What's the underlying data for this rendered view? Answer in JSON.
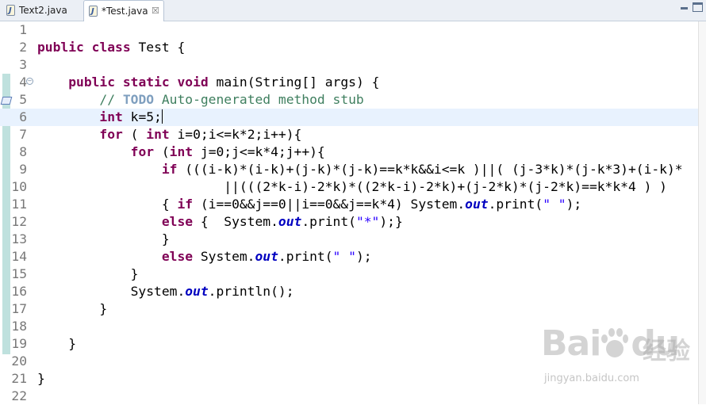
{
  "tabs": [
    {
      "label": "Text2.java",
      "active": false
    },
    {
      "label": "*Test.java",
      "active": true,
      "close": "☒"
    }
  ],
  "window_controls": {
    "minimize": "minimize-icon",
    "maximize": "maximize-icon"
  },
  "editor": {
    "current_line": 6,
    "lines": [
      {
        "n": "1",
        "tokens": []
      },
      {
        "n": "2",
        "tokens": [
          {
            "t": "public",
            "c": "kw"
          },
          {
            "t": " "
          },
          {
            "t": "class",
            "c": "kw"
          },
          {
            "t": " Test {"
          }
        ]
      },
      {
        "n": "3",
        "tokens": []
      },
      {
        "n": "4",
        "tokens": [
          {
            "t": "    "
          },
          {
            "t": "public",
            "c": "kw"
          },
          {
            "t": " "
          },
          {
            "t": "static",
            "c": "kw"
          },
          {
            "t": " "
          },
          {
            "t": "void",
            "c": "kw"
          },
          {
            "t": " main(String[] args) {"
          }
        ]
      },
      {
        "n": "5",
        "tokens": [
          {
            "t": "        "
          },
          {
            "t": "// ",
            "c": "cm"
          },
          {
            "t": "TODO",
            "c": "todo"
          },
          {
            "t": " Auto-generated method stub",
            "c": "cm"
          }
        ]
      },
      {
        "n": "6",
        "tokens": [
          {
            "t": "        "
          },
          {
            "t": "int",
            "c": "kw"
          },
          {
            "t": " k=5;"
          },
          {
            "t": "",
            "c": "caret"
          }
        ]
      },
      {
        "n": "7",
        "tokens": [
          {
            "t": "        "
          },
          {
            "t": "for",
            "c": "kw"
          },
          {
            "t": " ( "
          },
          {
            "t": "int",
            "c": "kw"
          },
          {
            "t": " i=0;i<=k*2;i++){"
          }
        ]
      },
      {
        "n": "8",
        "tokens": [
          {
            "t": "            "
          },
          {
            "t": "for",
            "c": "kw"
          },
          {
            "t": " ("
          },
          {
            "t": "int",
            "c": "kw"
          },
          {
            "t": " j=0;j<=k*4;j++){"
          }
        ]
      },
      {
        "n": "9",
        "tokens": [
          {
            "t": "                "
          },
          {
            "t": "if",
            "c": "kw"
          },
          {
            "t": " (((i-k)*(i-k)+(j-k)*(j-k)==k*k&&i<=k )||( (j-3*k)*(j-k*3)+(i-k)*"
          }
        ]
      },
      {
        "n": "10",
        "tokens": [
          {
            "t": "                        ||(((2*k-i)-2*k)*((2*k-i)-2*k)+(j-2*k)*(j-2*k)==k*k*4 ) )"
          }
        ]
      },
      {
        "n": "11",
        "tokens": [
          {
            "t": "                { "
          },
          {
            "t": "if",
            "c": "kw"
          },
          {
            "t": " (i==0&&j==0||i==0&&j==k*4) System."
          },
          {
            "t": "out",
            "c": "fld"
          },
          {
            "t": ".print("
          },
          {
            "t": "\" \"",
            "c": "st"
          },
          {
            "t": ");"
          }
        ]
      },
      {
        "n": "12",
        "tokens": [
          {
            "t": "                "
          },
          {
            "t": "else",
            "c": "kw"
          },
          {
            "t": " {  System."
          },
          {
            "t": "out",
            "c": "fld"
          },
          {
            "t": ".print("
          },
          {
            "t": "\"*\"",
            "c": "st"
          },
          {
            "t": ");}"
          }
        ]
      },
      {
        "n": "13",
        "tokens": [
          {
            "t": "                }"
          }
        ]
      },
      {
        "n": "14",
        "tokens": [
          {
            "t": "                "
          },
          {
            "t": "else",
            "c": "kw"
          },
          {
            "t": " System."
          },
          {
            "t": "out",
            "c": "fld"
          },
          {
            "t": ".print("
          },
          {
            "t": "\" \"",
            "c": "st"
          },
          {
            "t": ");"
          }
        ]
      },
      {
        "n": "15",
        "tokens": [
          {
            "t": "            }"
          }
        ]
      },
      {
        "n": "16",
        "tokens": [
          {
            "t": "            System."
          },
          {
            "t": "out",
            "c": "fld"
          },
          {
            "t": ".println();"
          }
        ]
      },
      {
        "n": "17",
        "tokens": [
          {
            "t": "        }"
          }
        ]
      },
      {
        "n": "18",
        "tokens": []
      },
      {
        "n": "19",
        "tokens": [
          {
            "t": "    }"
          }
        ]
      },
      {
        "n": "20",
        "tokens": []
      },
      {
        "n": "21",
        "tokens": [
          {
            "t": "}"
          }
        ]
      },
      {
        "n": "22",
        "tokens": []
      }
    ]
  },
  "watermark": {
    "logo_left": "Bai",
    "logo_right": "du",
    "cn": "经验",
    "url": "jingyan.baidu.com"
  },
  "colors": {
    "keyword": "#7f0055",
    "comment": "#3f7f5f",
    "string": "#2a00ff",
    "field": "#0000c0",
    "current_line": "#e8f2fe",
    "quick_diff": "#bfe1de"
  }
}
